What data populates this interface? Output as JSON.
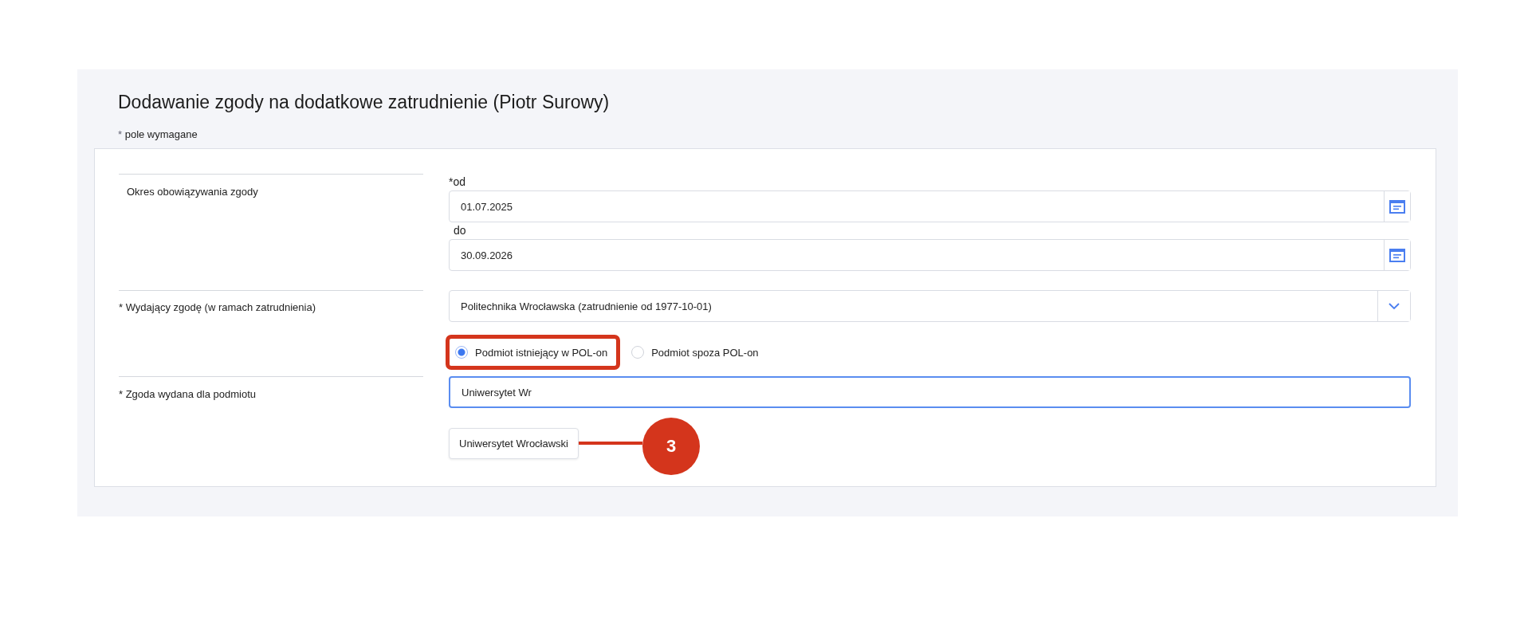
{
  "title": "Dodawanie zgody na dodatkowe zatrudnienie (Piotr Surowy)",
  "required_note": {
    "mark": "*",
    "text": "pole wymagane"
  },
  "period": {
    "label": "Okres obowiązywania zgody",
    "fields": [
      {
        "label": "*od",
        "value": "01.07.2025"
      },
      {
        "label": "do",
        "value": "30.09.2026"
      }
    ]
  },
  "issuer": {
    "label": "* Wydający zgodę (w ramach zatrudnienia)",
    "value": "Politechnika Wrocławska (zatrudnienie od 1977-10-01)",
    "options": [
      {
        "label": "Podmiot istniejący w POL-on",
        "selected": true,
        "highlighted": true
      },
      {
        "label": "Podmiot spoza POL-on",
        "selected": false,
        "highlighted": false
      }
    ]
  },
  "entity": {
    "label": "* Zgoda wydana dla podmiotu",
    "value": "Uniwersytet Wr",
    "focused": true,
    "suggestions": [
      "Uniwersytet Wrocławski"
    ]
  },
  "callout": {
    "label": "3"
  }
}
